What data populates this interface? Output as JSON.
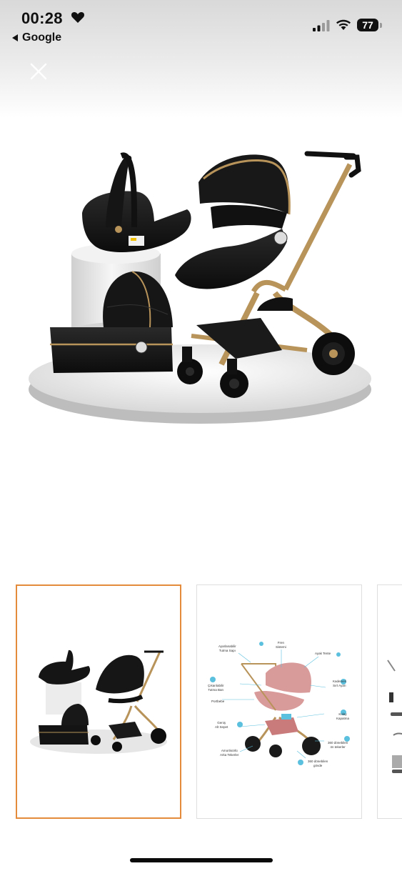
{
  "status_bar": {
    "time": "00:28",
    "back_label": "Google",
    "battery": "77"
  },
  "gallery": {
    "selected_index": 0,
    "thumbnail_2_labels": [
      "Ayarlanabilir\nTutma Sapı",
      "Fren\nSistemi",
      "Ayak Tente",
      "Çıkarılabilir\nTutma Barı",
      "Kademeli\nSırt Ayarı",
      "Portbebe",
      "Geniş\nAlt Sepet",
      "Kolay\nKapatma",
      "Amortisörlü\nArka Tekerler",
      "360 dönebilen\nön tekerler",
      "360 dönebilen\ngövde"
    ]
  },
  "colors": {
    "selected_border": "#e38b3a",
    "stroller_black": "#141414",
    "stroller_gold": "#b8935a",
    "stroller_pink": "#d99a9a",
    "feature_blue": "#5bc0de"
  }
}
